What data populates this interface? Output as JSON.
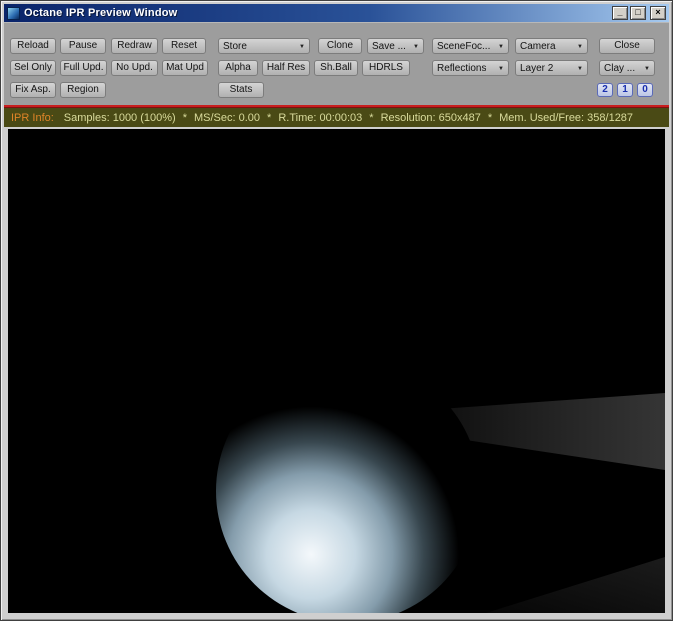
{
  "window": {
    "title": "Octane IPR Preview Window",
    "minimize_glyph": "_",
    "maximize_glyph": "□",
    "close_glyph": "×"
  },
  "toolbar": {
    "dropdown_arrow": "▼",
    "row1": [
      {
        "label": "Reload"
      },
      {
        "label": "Pause"
      },
      {
        "label": "Redraw"
      },
      {
        "label": "Reset"
      },
      {
        "label": "Store",
        "dropdown": true
      },
      {
        "label": "Clone"
      },
      {
        "label": "Save ...",
        "dropdown": true
      },
      {
        "label": "SceneFoc...",
        "dropdown": true
      },
      {
        "label": "Camera",
        "dropdown": true
      },
      {
        "label": "Close"
      }
    ],
    "row2": [
      {
        "label": "Sel Only"
      },
      {
        "label": "Full Upd."
      },
      {
        "label": "No Upd."
      },
      {
        "label": "Mat Upd"
      },
      {
        "label": "Alpha"
      },
      {
        "label": "Half Res"
      },
      {
        "label": "Sh.Ball"
      },
      {
        "label": "HDRLS"
      },
      {
        "label": "Reflections",
        "dropdown": true
      },
      {
        "label": "Layer 2",
        "dropdown": true
      },
      {
        "label": "Clay ...",
        "dropdown": true
      }
    ],
    "row3": [
      {
        "label": "Fix Asp."
      },
      {
        "label": "Region"
      },
      {
        "label": "Stats"
      }
    ],
    "toggle_buttons": [
      {
        "label": "2"
      },
      {
        "label": "1"
      },
      {
        "label": "0"
      }
    ]
  },
  "info_bar": {
    "label": "IPR Info:",
    "separator": "*",
    "samples": "Samples: 1000 (100%)",
    "ms_per_sec": "MS/Sec: 0.00",
    "render_time": "R.Time: 00:00:03",
    "resolution": "Resolution: 650x487",
    "memory": "Mem. Used/Free: 358/1287"
  },
  "colors": {
    "titlebar_start": "#0a246a",
    "titlebar_end": "#a6caf0",
    "toolbar_bg": "#9d9d9d",
    "red_divider": "#c81e1e",
    "info_bg": "#4a4a15",
    "info_label": "#e08428",
    "info_text": "#d9db9c"
  }
}
